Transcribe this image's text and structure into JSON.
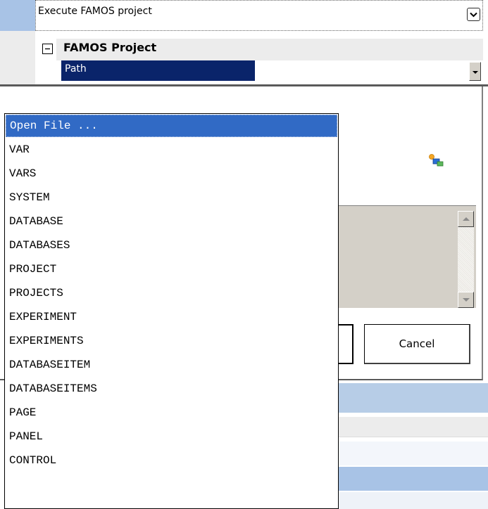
{
  "property_grid": {
    "execute_label": "Execute FAMOS project",
    "category_label": "FAMOS Project",
    "path_label": "Path"
  },
  "dialog": {
    "cancel_label": "Cancel"
  },
  "dropdown": {
    "selected_index": 0,
    "items": [
      "Open File ...",
      "VAR",
      "VARS",
      "SYSTEM",
      "DATABASE",
      "DATABASES",
      "PROJECT",
      "PROJECTS",
      "EXPERIMENT",
      "EXPERIMENTS",
      "DATABASEITEM",
      "DATABASEITEMS",
      "PAGE",
      "PANEL",
      "CONTROL"
    ]
  },
  "colors": {
    "selection_blue": "#316ac5",
    "grid_selection": "#0a246a",
    "row_highlight": "#a8c3e6"
  },
  "icons": [
    "chevron-down-icon",
    "collapse-icon",
    "network-icon",
    "scroll-up-icon",
    "scroll-down-icon"
  ]
}
